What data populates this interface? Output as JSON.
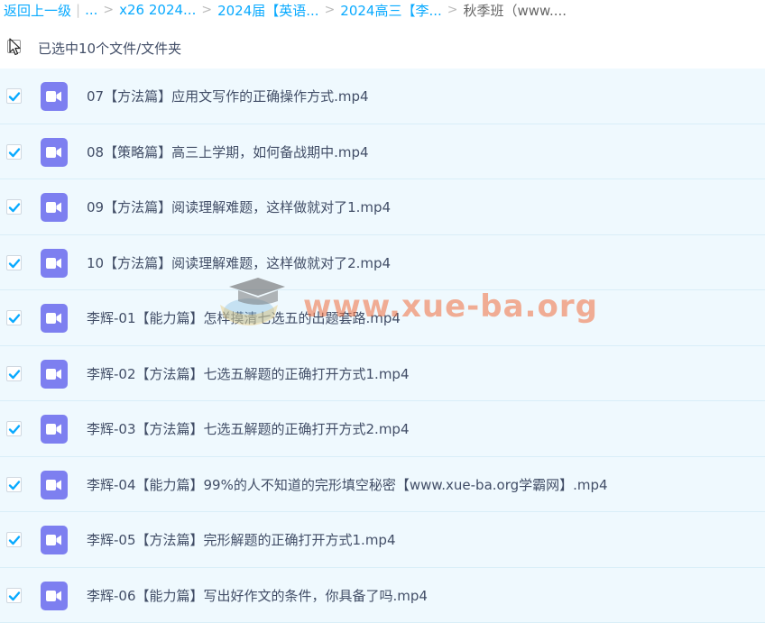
{
  "breadcrumb": {
    "back": "返回上一级",
    "ellipsis": "...",
    "items": [
      "x26 2024...",
      "2024届【英语...",
      "2024高三【李...",
      "秋季班（www...."
    ]
  },
  "selection": {
    "count_text": "已选中10个文件/文件夹"
  },
  "files": [
    "07【方法篇】应用文写作的正确操作方式.mp4",
    "08【策略篇】高三上学期，如何备战期中.mp4",
    "09【方法篇】阅读理解难题，这样做就对了1.mp4",
    "10【方法篇】阅读理解难题，这样做就对了2.mp4",
    "李辉-01【能力篇】怎样摸清七选五的出题套路.mp4",
    "李辉-02【方法篇】七选五解题的正确打开方式1.mp4",
    "李辉-03【方法篇】七选五解题的正确打开方式2.mp4",
    "李辉-04【能力篇】99%的人不知道的完形填空秘密【www.xue-ba.org学霸网】.mp4",
    "李辉-05【方法篇】完形解题的正确打开方式1.mp4",
    "李辉-06【能力篇】写出好作文的条件，你具备了吗.mp4"
  ],
  "watermark": {
    "text": "www.xue-ba.org"
  },
  "colors": {
    "accent": "#09aaff",
    "row_bg": "#eff9fe",
    "video_icon": "#7d7ff0",
    "text": "#424e67"
  }
}
